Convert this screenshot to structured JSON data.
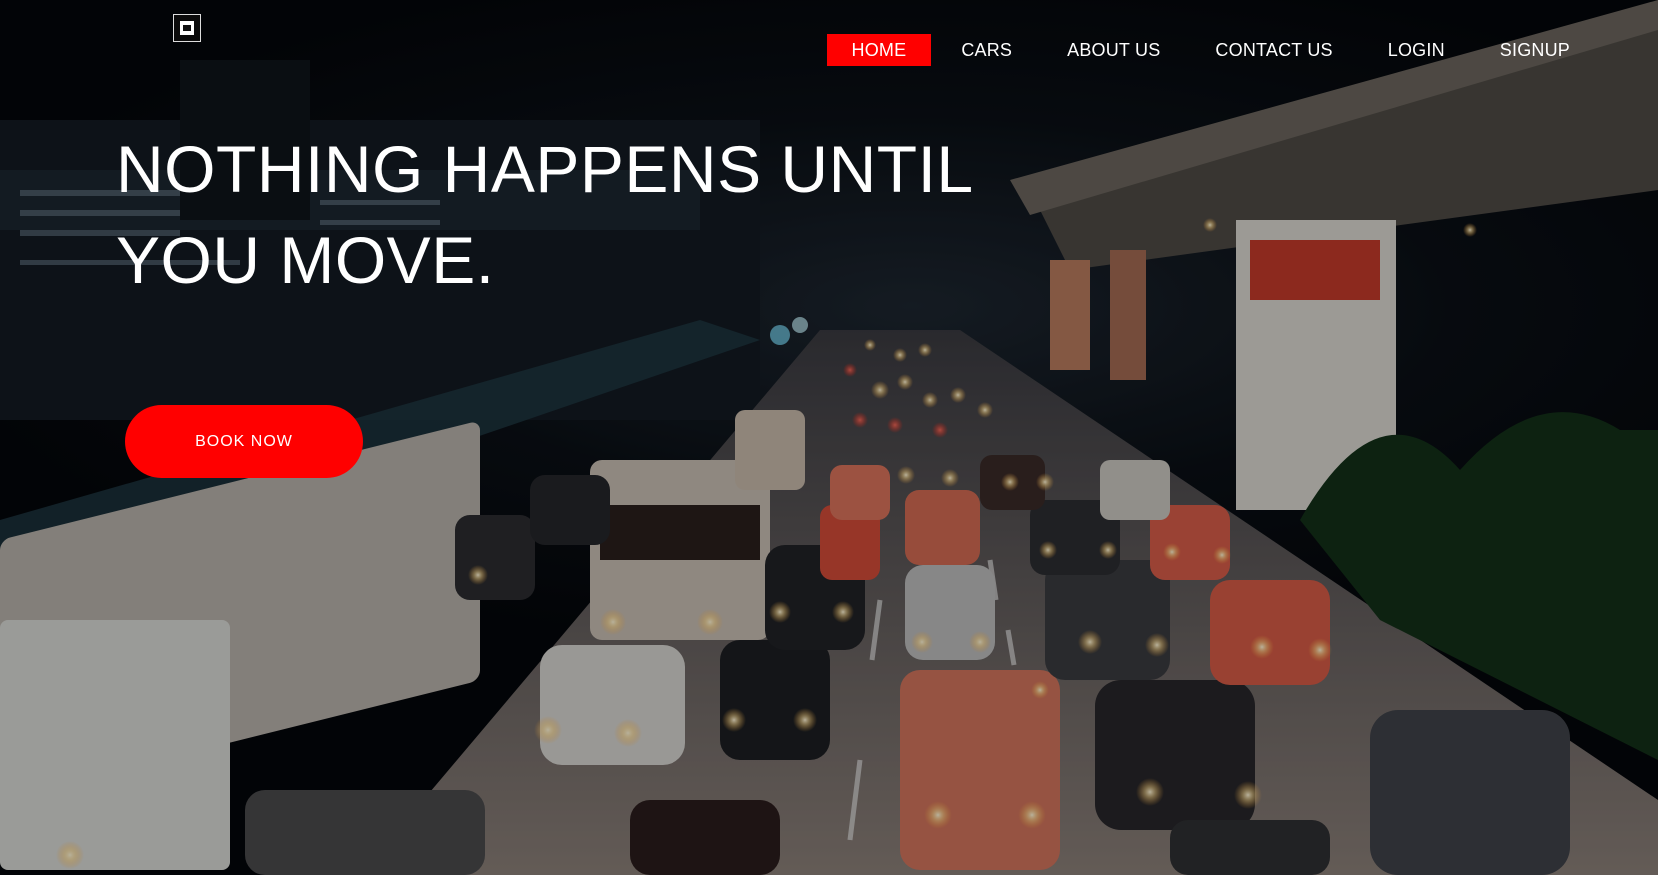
{
  "brand": {
    "logo_icon": "car-logo-icon"
  },
  "nav": {
    "items": [
      {
        "label": "HOME",
        "active": true
      },
      {
        "label": "CARS",
        "active": false
      },
      {
        "label": "ABOUT US",
        "active": false
      },
      {
        "label": "CONTACT US",
        "active": false
      },
      {
        "label": "LOGIN",
        "active": false
      },
      {
        "label": "SIGNUP",
        "active": false
      }
    ]
  },
  "hero": {
    "headline_line1": "NOTHING HAPPENS UNTIL",
    "headline_line2": "YOU MOVE.",
    "cta_label": "BOOK NOW",
    "background": "night-city-traffic-photo"
  },
  "colors": {
    "accent": "#ff0000",
    "text": "#ffffff",
    "overlay": "#000000"
  }
}
